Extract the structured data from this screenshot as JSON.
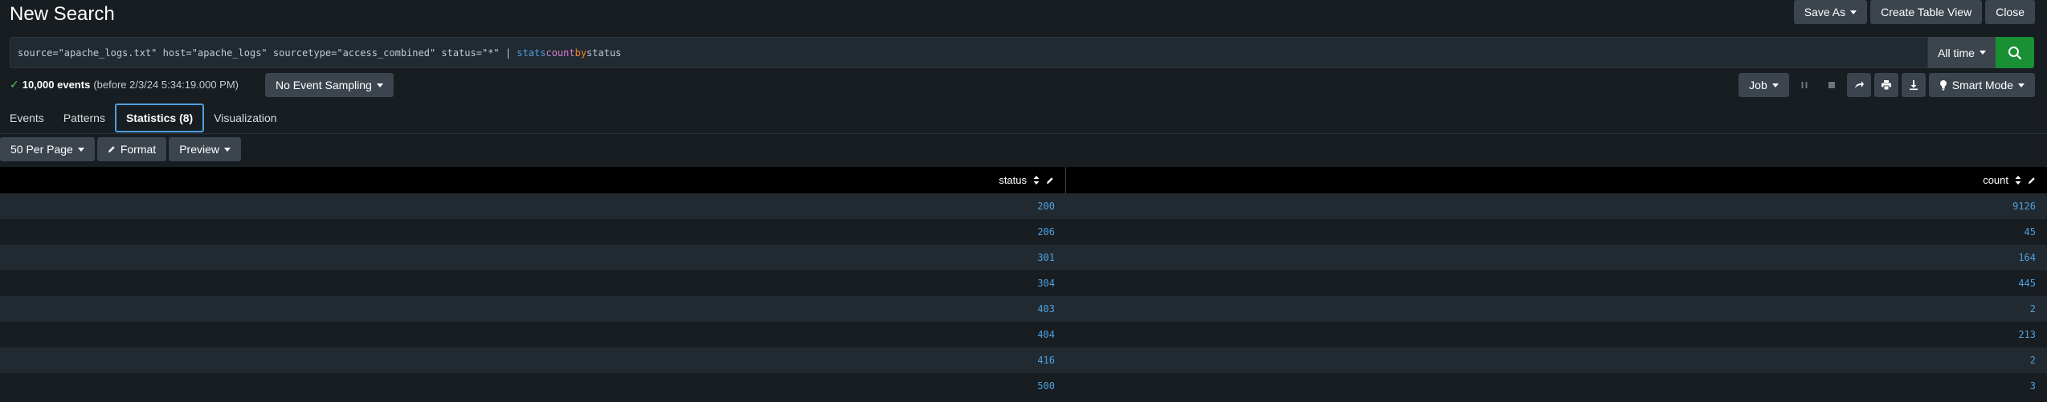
{
  "page": {
    "title": "New Search"
  },
  "header_actions": {
    "save_as": "Save As",
    "create_table_view": "Create Table View",
    "close": "Close"
  },
  "search": {
    "query_parts": {
      "base": "source=\"apache_logs.txt\" host=\"apache_logs\" sourcetype=\"access_combined\" status=\"*\"",
      "pipe": " | ",
      "command": "stats",
      "func": "count",
      "by": "by",
      "field": "status"
    },
    "time_range": "All time"
  },
  "status": {
    "events": "10,000 events",
    "before": "(before 2/3/24 5:34:19.000 PM)",
    "sampling": "No Event Sampling"
  },
  "job": {
    "label": "Job",
    "mode": "Smart Mode"
  },
  "tabs": [
    {
      "label": "Events"
    },
    {
      "label": "Patterns"
    },
    {
      "label": "Statistics (8)"
    },
    {
      "label": "Visualization"
    }
  ],
  "toolbar": {
    "per_page": "50 Per Page",
    "format": "Format",
    "preview": "Preview"
  },
  "table": {
    "columns": [
      "status",
      "count"
    ],
    "rows": [
      [
        "200",
        "9126"
      ],
      [
        "206",
        "45"
      ],
      [
        "301",
        "164"
      ],
      [
        "304",
        "445"
      ],
      [
        "403",
        "2"
      ],
      [
        "404",
        "213"
      ],
      [
        "416",
        "2"
      ],
      [
        "500",
        "3"
      ]
    ]
  },
  "colors": {
    "accent": "#4fa0e0",
    "search_button": "#1a9035",
    "background": "#171d21"
  }
}
